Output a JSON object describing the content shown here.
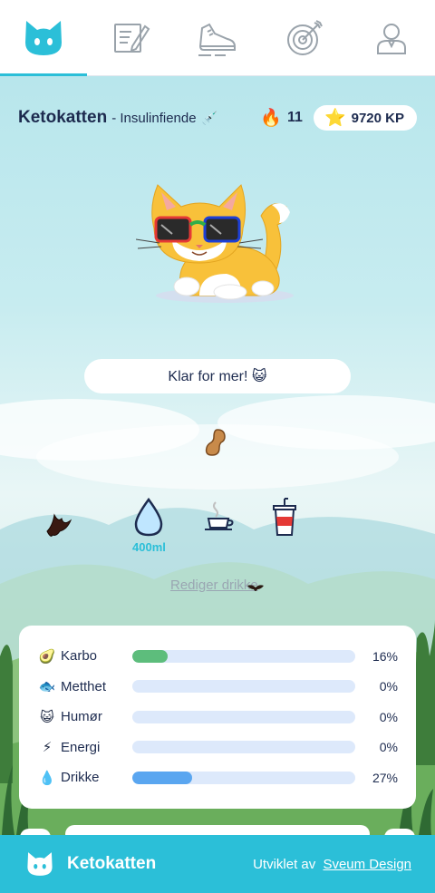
{
  "nav": {
    "tabs": [
      {
        "icon": "cat-face-icon",
        "active": true
      },
      {
        "icon": "notepad-pencil-icon",
        "active": false
      },
      {
        "icon": "sneaker-icon",
        "active": false
      },
      {
        "icon": "target-icon",
        "active": false
      },
      {
        "icon": "user-profile-icon",
        "active": false
      }
    ]
  },
  "header": {
    "cat_name": "Ketokatten",
    "cat_title": "- Insulinfiende",
    "streak": "11",
    "kp": "9720 KP"
  },
  "bubble": {
    "text": "Klar for mer! 😺"
  },
  "drinks": {
    "water_amount": "400ml",
    "edit_link": "Rediger drikke",
    "items": [
      "water-drop-icon",
      "coffee-cup-icon",
      "soda-cup-icon"
    ]
  },
  "stats": {
    "rows": [
      {
        "label": "Karbo",
        "value": "16%",
        "fraction": 0.16,
        "color": "#5dbd7c",
        "icon": "avocado-icon"
      },
      {
        "label": "Metthet",
        "value": "0%",
        "fraction": 0.0,
        "color": "#5aa6f0",
        "icon": "fish-icon"
      },
      {
        "label": "Humør",
        "value": "0%",
        "fraction": 0.0,
        "color": "#5aa6f0",
        "icon": "cat-emoji-icon"
      },
      {
        "label": "Energi",
        "value": "0%",
        "fraction": 0.0,
        "color": "#5aa6f0",
        "icon": "lightning-icon"
      },
      {
        "label": "Drikke",
        "value": "27%",
        "fraction": 0.27,
        "color": "#5aa6f0",
        "icon": "water-drop-icon"
      }
    ]
  },
  "footer": {
    "app_name": "Ketokatten",
    "credit": "Utviklet av",
    "credit_link": "Sveum Design"
  },
  "colors": {
    "accent": "#2bbfd8",
    "ink": "#1d2b4f"
  }
}
